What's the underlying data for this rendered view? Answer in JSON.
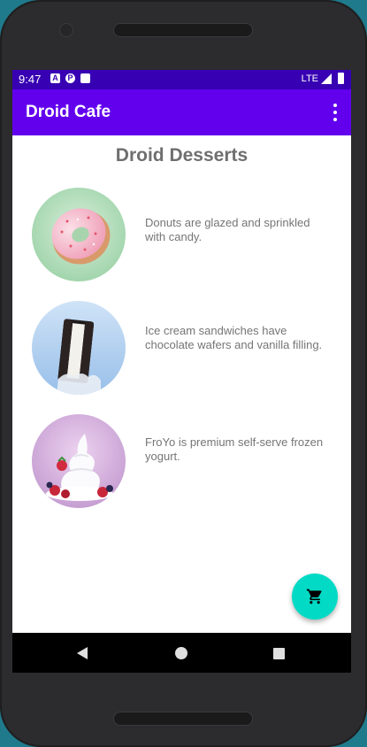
{
  "status_bar": {
    "time": "9:47",
    "network": "LTE",
    "notification_icons": [
      "A",
      "P",
      ""
    ]
  },
  "app_bar": {
    "title": "Droid Cafe",
    "menu_icon": "overflow-menu-icon"
  },
  "page": {
    "title": "Droid Desserts"
  },
  "desserts": [
    {
      "image": "donut-image",
      "description": "Donuts are glazed and sprinkled with candy."
    },
    {
      "image": "ice-cream-sandwich-image",
      "description": "Ice cream sandwiches have chocolate wafers and vanilla filling."
    },
    {
      "image": "froyo-image",
      "description": "FroYo is premium self-serve frozen yogurt."
    }
  ],
  "fab": {
    "icon": "shopping-cart-icon"
  },
  "nav_bar": {
    "back_icon": "back-icon",
    "home_icon": "home-icon",
    "recents_icon": "recents-icon"
  },
  "colors": {
    "status_bar": "#3700b3",
    "primary": "#6200ee",
    "accent": "#03dac5",
    "page_title": "#6f6f6f",
    "body_text": "#757575"
  }
}
